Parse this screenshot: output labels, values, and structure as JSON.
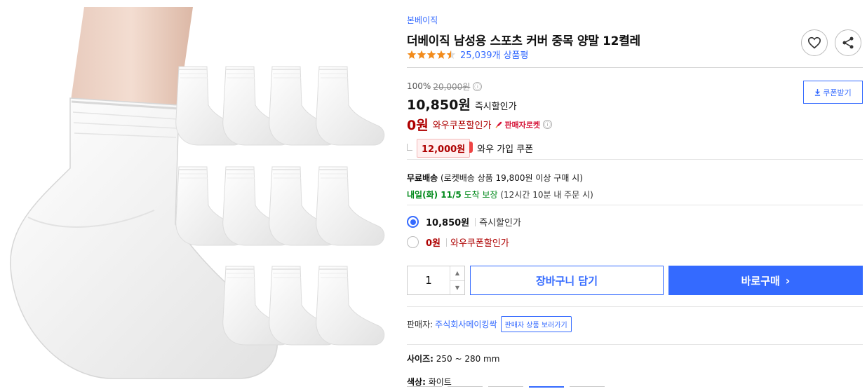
{
  "product": {
    "brand": "본베이직",
    "title": "더베이직 남성용 스포츠 커버 중목 양말 12켤레",
    "rating_value": 4.5,
    "review_count": "25,039개 상품평"
  },
  "price": {
    "discount_rate": "100%",
    "original_price": "20,000원",
    "info_icon": "ⓘ",
    "sale_price": "10,850원",
    "sale_label": "즉시할인가",
    "wow_price": "0원",
    "wow_label": "와우쿠폰할인가",
    "rocket_badge": "판매자로켓",
    "coupon_amount": "12,000원",
    "coupon_label": "와우 가입 쿠폰",
    "coupon_button": "쿠폰받기"
  },
  "shipping": {
    "label": "무료배송",
    "condition": "(로켓배송 상품 19,800원 이상 구매 시)",
    "arrive_date": "내일(화) 11/5",
    "arrive_text": "도착 보장",
    "arrive_sub": "(12시간 10분 내 주문 시)"
  },
  "options": [
    {
      "price": "10,850원",
      "label": "즉시할인가",
      "selected": true
    },
    {
      "price": "0원",
      "label": "와우쿠폰할인가",
      "selected": false
    }
  ],
  "purchase": {
    "quantity": "1",
    "cart_button": "장바구니 담기",
    "buy_button": "바로구매",
    "buy_chevron": "›"
  },
  "seller": {
    "label": "판매자:",
    "name": "주식회사메이킹싹",
    "link": "판매자 상품 보러가기"
  },
  "specs": {
    "size_label": "사이즈:",
    "size_value": "250 ~ 280 mm",
    "color_label": "색상:",
    "color_value": "화이트"
  },
  "colors": {
    "accent": "#346aff",
    "wow_red": "#ae0000",
    "arrival_green": "#00891a",
    "star_orange": "#f28b1b"
  },
  "icons": {
    "heart": "heart-icon",
    "share": "share-icon",
    "download": "download-icon",
    "qty_up": "▲",
    "qty_down": "▼",
    "rocket": "rocket-icon"
  }
}
